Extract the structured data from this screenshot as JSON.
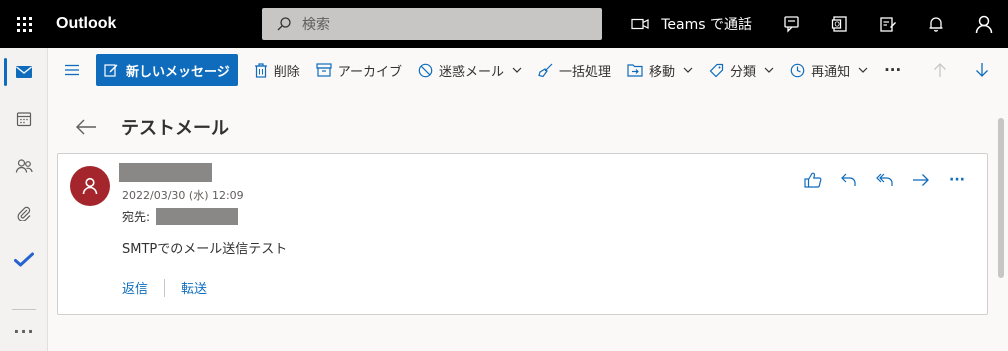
{
  "app": {
    "title": "Outlook"
  },
  "search": {
    "placeholder": "検索"
  },
  "topbar": {
    "teams_label": "Teams で通話"
  },
  "toolbar": {
    "new_message": "新しいメッセージ",
    "delete": "削除",
    "archive": "アーカイブ",
    "junk": "迷惑メール",
    "sweep": "一括処理",
    "move": "移動",
    "categorize": "分類",
    "snooze": "再通知",
    "more": "···"
  },
  "message": {
    "subject": "テストメール",
    "date": "2022/03/30 (水) 12:09",
    "to_label": "宛先:",
    "body": "SMTPでのメール送信テスト",
    "reply": "返信",
    "forward": "転送",
    "more": "···"
  },
  "rail": {
    "more": "···"
  },
  "colors": {
    "accent": "#0f6cbd",
    "avatar": "#a4262c",
    "topbar": "#000000"
  }
}
